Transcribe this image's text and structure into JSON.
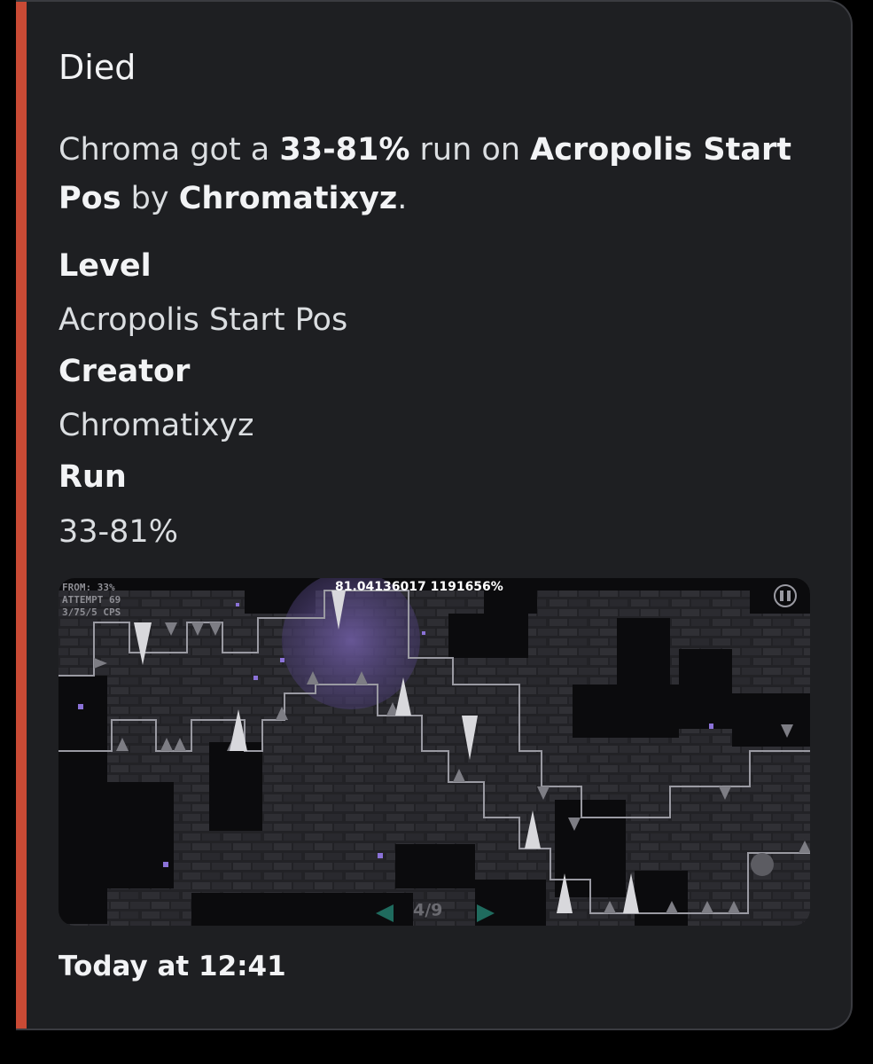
{
  "embed": {
    "accent_color": "#c94a35",
    "title": "Died",
    "description": {
      "player": "Chroma",
      "text_got": " got a ",
      "run": "33-81%",
      "text_run_on": " run on ",
      "level": "Acropolis Start Pos",
      "text_by": " by ",
      "creator": "Chromatixyz",
      "text_end": "."
    },
    "fields": [
      {
        "name": "Level",
        "value": "Acropolis Start Pos"
      },
      {
        "name": "Creator",
        "value": "Chromatixyz"
      },
      {
        "name": "Run",
        "value": "33-81%"
      }
    ],
    "image": {
      "percent_readout": "81.04136017 1191656%",
      "hud_from": "FROM: 33%",
      "hud_attempt": "ATTEMPT 69",
      "hud_cps": "3/75/5 CPS",
      "page_indicator": "4/9",
      "pause_icon": "pause-icon",
      "prev_icon": "triangle-left-icon",
      "next_icon": "triangle-right-icon"
    },
    "timestamp": "Today at 12:41"
  }
}
